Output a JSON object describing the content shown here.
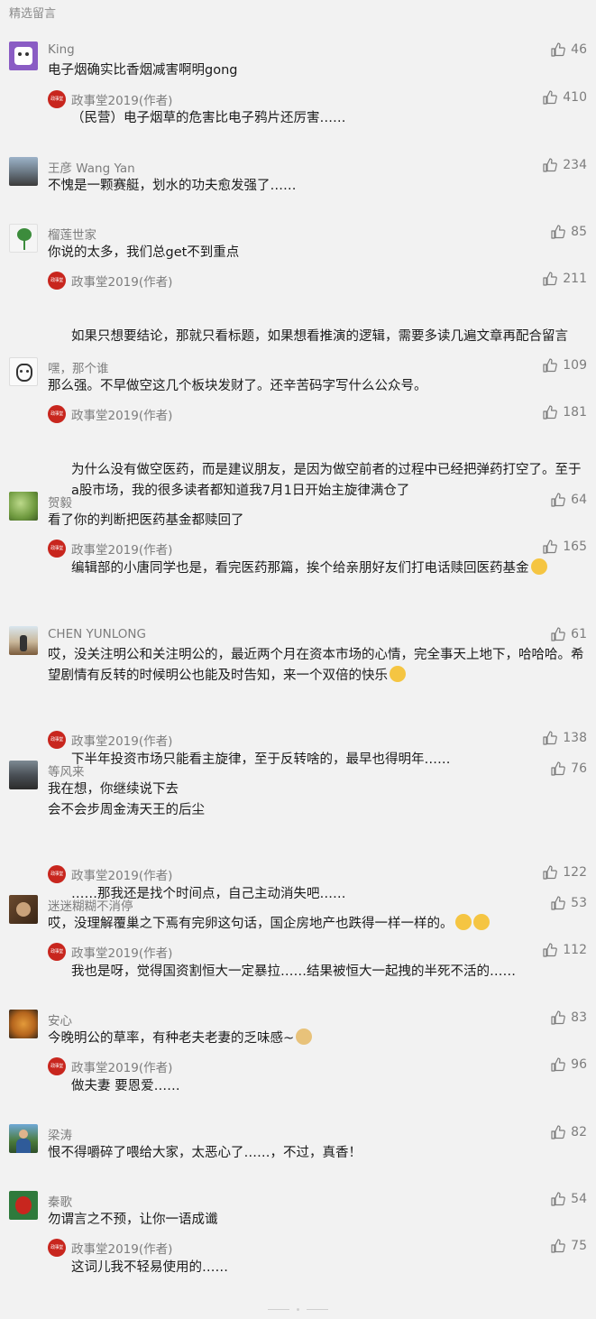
{
  "header": {
    "title": "精选留言"
  },
  "icons": {
    "like": "thumbs-up-icon",
    "author_badge": "author-badge-icon",
    "emoji": "emoji-icon"
  },
  "colors": {
    "author_badge": "#c8261e",
    "meta_text": "#7d7d7d",
    "background": "#f2f2f2"
  },
  "comments": [
    {
      "name": "King",
      "likes": "46",
      "text": "电子烟确实比香烟减害啊明gong",
      "reply": {
        "author": "政事堂2019(作者)",
        "likes": "410",
        "text": "（民营）电子烟草的危害比电子鸦片还厉害……"
      }
    },
    {
      "name": "王彦 Wang Yan",
      "likes": "234",
      "text": "不愧是一颗赛艇，划水的功夫愈发强了……"
    },
    {
      "name": "榴莲世家",
      "likes": "85",
      "text": "你说的太多，我们总get不到重点",
      "reply": {
        "author": "政事堂2019(作者)",
        "likes": "211",
        "text": "如果只想要结论，那就只看标题，如果想看推演的逻辑，需要多读几遍文章再配合留言"
      }
    },
    {
      "name": "嘿，那个谁",
      "likes": "109",
      "text": "那么强。不早做空这几个板块发财了。还辛苦码字写什么公众号。",
      "reply": {
        "author": "政事堂2019(作者)",
        "likes": "181",
        "text": "为什么没有做空医药，而是建议朋友，是因为做空前者的过程中已经把弹药打空了。至于a股市场，我的很多读者都知道我7月1日开始主旋律满仓了"
      }
    },
    {
      "name": "贺毅",
      "likes": "64",
      "text": "看了你的判断把医药基金都赎回了",
      "reply": {
        "author": "政事堂2019(作者)",
        "likes": "165",
        "text": "编辑部的小唐同学也是，看完医药那篇，挨个给亲朋好友们打电话赎回医药基金"
      }
    },
    {
      "name": "CHEN YUNLONG",
      "likes": "61",
      "text": "哎，没关注明公和关注明公的，最近两个月在资本市场的心情，完全事天上地下，哈哈哈。希望剧情有反转的时候明公也能及时告知，来一个双倍的快乐",
      "reply": {
        "author": "政事堂2019(作者)",
        "likes": "138",
        "text": "下半年投资市场只能看主旋律，至于反转啥的，最早也得明年……"
      }
    },
    {
      "name": "等风来",
      "likes": "76",
      "text": "我在想，你继续说下去\n会不会步周金涛天王的后尘",
      "reply": {
        "author": "政事堂2019(作者)",
        "likes": "122",
        "text": "……那我还是找个时间点，自己主动消失吧……"
      }
    },
    {
      "name": "迷迷糊糊不消停",
      "likes": "53",
      "text": "哎，没理解覆巢之下焉有完卵这句话，国企房地产也跌得一样一样的。",
      "reply": {
        "author": "政事堂2019(作者)",
        "likes": "112",
        "text": "我也是呀，觉得国资割恒大一定暴拉……结果被恒大一起拽的半死不活的……"
      }
    },
    {
      "name": "安心",
      "likes": "83",
      "text": "今晚明公的草率，有种老夫老妻的乏味感~",
      "reply": {
        "author": "政事堂2019(作者)",
        "likes": "96",
        "text": "做夫妻 要恩爱……"
      }
    },
    {
      "name": "梁涛",
      "likes": "82",
      "text": "恨不得嚼碎了喂给大家，太恶心了……，不过，真香！"
    },
    {
      "name": "秦歌",
      "likes": "54",
      "text": "勿谓言之不预，让你一语成谶",
      "reply": {
        "author": "政事堂2019(作者)",
        "likes": "75",
        "text": "这词儿我不轻易使用的……"
      }
    }
  ]
}
